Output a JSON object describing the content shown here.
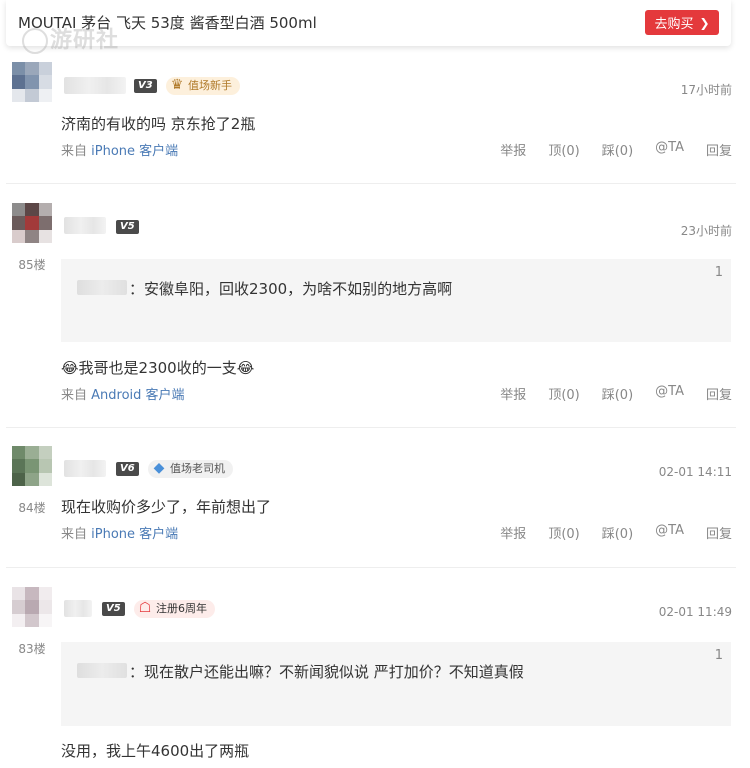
{
  "product": {
    "title": "MOUTAI 茅台 飞天 53度 酱香型白酒 500ml",
    "buy_label": "去购买",
    "buy_color": "#e4393c"
  },
  "watermark": {
    "text": "游研社"
  },
  "actions": {
    "report": "举报",
    "up": "顶(0)",
    "down": "踩(0)",
    "at": "@TA",
    "reply": "回复"
  },
  "comments": [
    {
      "level": "V3",
      "badge": "值场新手",
      "time": "17小时前",
      "text": "济南的有收的吗 京东抢了2瓶",
      "source_prefix": "来自",
      "device": "iPhone 客户端"
    },
    {
      "floor": "85楼",
      "level": "V5",
      "time": "23小时前",
      "quote": {
        "text": "：安徽阜阳，回收2300，为啥不如别的地方高啊",
        "num": "1"
      },
      "text": "我哥也是2300收的一支",
      "emoji": "😂",
      "source_prefix": "来自",
      "device": "Android 客户端"
    },
    {
      "floor": "84楼",
      "level": "V6",
      "badge": "值场老司机",
      "time": "02-01 14:11",
      "text": "现在收购价多少了，年前想出了",
      "source_prefix": "来自",
      "device": "iPhone 客户端"
    },
    {
      "floor": "83楼",
      "level": "V5",
      "badge": "注册6周年",
      "time": "02-01 11:49",
      "quote": {
        "text": "：现在散户还能出嘛？不新闻貌似说 严打加价？不知道真假",
        "num": "1"
      },
      "text": "没用，我上午4600出了两瓶"
    }
  ]
}
